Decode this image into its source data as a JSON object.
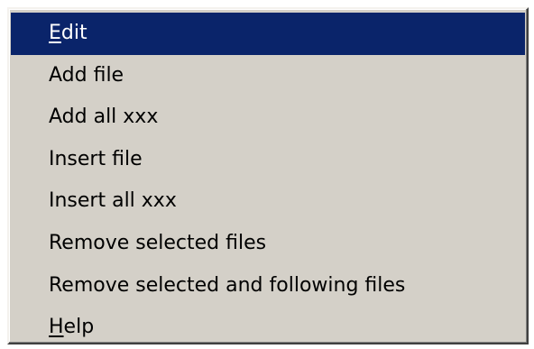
{
  "menu": {
    "items": [
      {
        "mnemonic": "E",
        "rest": "dit",
        "selected": true
      },
      {
        "mnemonic": "",
        "rest": "Add file",
        "selected": false
      },
      {
        "mnemonic": "",
        "rest": "Add all xxx",
        "selected": false
      },
      {
        "mnemonic": "",
        "rest": "Insert file",
        "selected": false
      },
      {
        "mnemonic": "",
        "rest": "Insert all xxx",
        "selected": false
      },
      {
        "mnemonic": "",
        "rest": "Remove selected files",
        "selected": false
      },
      {
        "mnemonic": "",
        "rest": "Remove selected and following files",
        "selected": false
      },
      {
        "mnemonic": "H",
        "rest": "elp",
        "selected": false
      }
    ]
  },
  "colors": {
    "menu_background": "#d4d0c8",
    "selection_background": "#0a246a",
    "selection_text": "#ffffff",
    "text": "#000000"
  }
}
